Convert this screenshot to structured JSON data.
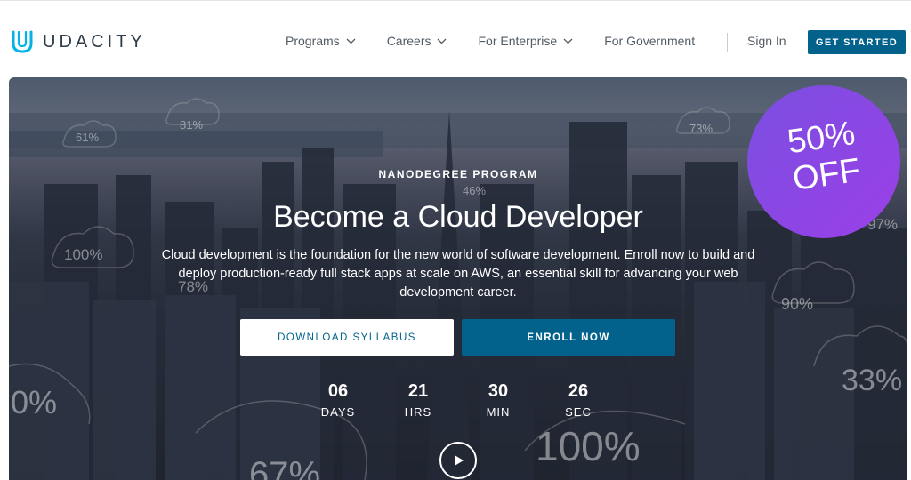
{
  "brand": {
    "name": "UDACITY"
  },
  "nav": {
    "items": [
      {
        "label": "Programs",
        "has_dropdown": true
      },
      {
        "label": "Careers",
        "has_dropdown": true
      },
      {
        "label": "For Enterprise",
        "has_dropdown": true
      },
      {
        "label": "For Government",
        "has_dropdown": false
      }
    ],
    "sign_in": "Sign In",
    "cta": "GET STARTED"
  },
  "hero": {
    "eyebrow": "NANODEGREE PROGRAM",
    "title": "Become a Cloud Developer",
    "description": "Cloud development is the foundation for the new world of software development. Enroll now to build and deploy production-ready full stack apps at scale on AWS, an essential skill for advancing your web development career.",
    "download_label": "DOWNLOAD SYLLABUS",
    "enroll_label": "ENROLL NOW",
    "countdown": [
      {
        "value": "06",
        "label": "DAYS"
      },
      {
        "value": "21",
        "label": "HRS"
      },
      {
        "value": "30",
        "label": "MIN"
      },
      {
        "value": "26",
        "label": "SEC"
      }
    ],
    "badge_line1": "50%",
    "badge_line2": "OFF",
    "background_percentages": [
      "61%",
      "81%",
      "73%",
      "100%",
      "78%",
      "46%",
      "97%",
      "90%",
      "0%",
      "33%",
      "100%",
      "67%"
    ]
  },
  "colors": {
    "brand_blue": "#02628c",
    "badge_purple": "#8a46e6",
    "text_dark": "#2e3d49"
  }
}
